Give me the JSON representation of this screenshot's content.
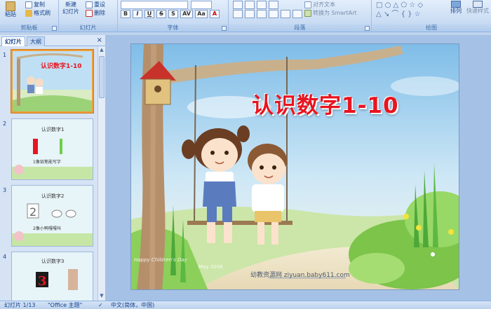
{
  "ribbon": {
    "clipboard": {
      "paste": "粘贴",
      "copy": "复制",
      "format_painter": "格式刷",
      "label": "剪贴板"
    },
    "slides": {
      "new_slide": "新建",
      "new_slide_line2": "幻灯片",
      "reset": "重设",
      "delete": "删除",
      "label": "幻灯片"
    },
    "font": {
      "label": "字体",
      "bold": "B",
      "italic": "I",
      "underline": "U",
      "strike": "S",
      "shadow": "S",
      "spacing": "AV",
      "case": "Aa",
      "color": "A"
    },
    "paragraph": {
      "label": "段落",
      "align_text": "对齐文本",
      "convert_smartart": "转换为 SmartArt"
    },
    "drawing": {
      "label": "绘图",
      "arrange": "排列",
      "quick_styles": "快速样式"
    }
  },
  "left_pane": {
    "tabs": [
      "幻灯片",
      "大纲"
    ],
    "close": "×",
    "thumbnails": [
      {
        "num": "1",
        "title": "认识数字1-10"
      },
      {
        "num": "2",
        "title": "认识数字1",
        "caption": "1像铅笔能写字"
      },
      {
        "num": "3",
        "title": "认识数字2",
        "caption": "2像小鸭嘎嘎叫"
      },
      {
        "num": "4",
        "title": "认识数字3"
      }
    ]
  },
  "slide": {
    "title": "认识数字1-10",
    "watermark_line1": "Happy Children's Day",
    "watermark_line2": "May 2008",
    "footer": "幼教资源网 ziyuan.baby611.com"
  },
  "statusbar": {
    "slide_count": "幻灯片 1/13",
    "theme": "\"Office 主题\"",
    "language": "中文(简体，中国)"
  },
  "colors": {
    "title_red": "#e8141f",
    "ribbon_text": "#15428b",
    "selection_orange": "#f29d38"
  }
}
